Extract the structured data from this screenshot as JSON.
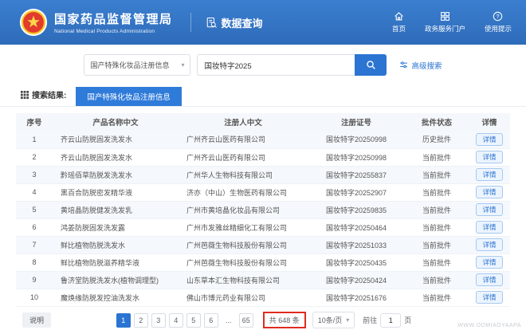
{
  "header": {
    "brand": {
      "title": "国家药品监督管理局",
      "subtitle": "National Medical Products Administration"
    },
    "app_title": "数据查询",
    "nav": [
      {
        "label": "首页",
        "icon": "home-icon"
      },
      {
        "label": "政务服务门户",
        "icon": "portal-icon"
      },
      {
        "label": "使用提示",
        "icon": "help-icon"
      }
    ]
  },
  "search": {
    "category_value": "国产特殊化妆品注册信息",
    "query_value": "国妆特字2025",
    "advanced_label": "高级搜索"
  },
  "results": {
    "label": "搜索结果:",
    "active_tab": "国产特殊化妆品注册信息"
  },
  "table": {
    "columns": [
      "序号",
      "产品名称中文",
      "注册人中文",
      "注册证号",
      "批件状态",
      "详情"
    ],
    "detail_label": "详情",
    "rows": [
      {
        "no": "1",
        "product": "齐云山防脱固发洗发水",
        "registrant": "广州齐云山医药有限公司",
        "cert": "国妆特字20250998",
        "status": "历史批件"
      },
      {
        "no": "2",
        "product": "齐云山防脱固发洗发水",
        "registrant": "广州齐云山医药有限公司",
        "cert": "国妆特字20250998",
        "status": "当前批件"
      },
      {
        "no": "3",
        "product": "黔瑶佰草防脱发洗发水",
        "registrant": "广州华人生物科技有限公司",
        "cert": "国妆特字20255837",
        "status": "当前批件"
      },
      {
        "no": "4",
        "product": "黑百合防脱密发精华液",
        "registrant": "济亦（中山）生物医药有限公司",
        "cert": "国妆特字20252907",
        "status": "当前批件"
      },
      {
        "no": "5",
        "product": "黄培晶防脱健发洗发乳",
        "registrant": "广州市黄培晶化妆品有限公司",
        "cert": "国妆特字20259835",
        "status": "当前批件"
      },
      {
        "no": "6",
        "product": "鸿姜防脱固发洗发露",
        "registrant": "广州市发雅丝精细化工有限公司",
        "cert": "国妆特字20250464",
        "status": "当前批件"
      },
      {
        "no": "7",
        "product": "鲜比植物防脱洗发水",
        "registrant": "广州芭薇生物科技股份有限公司",
        "cert": "国妆特字20251033",
        "status": "当前批件"
      },
      {
        "no": "8",
        "product": "鲜比植物防脱滋养精华液",
        "registrant": "广州芭薇生物科技股份有限公司",
        "cert": "国妆特字20250435",
        "status": "当前批件"
      },
      {
        "no": "9",
        "product": "鲁济堂防脱洗发水(植物调理型)",
        "registrant": "山东草本汇生物科技有限公司",
        "cert": "国妆特字20250424",
        "status": "当前批件"
      },
      {
        "no": "10",
        "product": "魔焕缘防脱发控油洗发水",
        "registrant": "佛山市博元药业有限公司",
        "cert": "国妆特字20251676",
        "status": "当前批件"
      }
    ]
  },
  "pagination": {
    "note_label": "说明",
    "pages": [
      "1",
      "2",
      "3",
      "4",
      "5",
      "6",
      "...",
      "65"
    ],
    "active_page": "1",
    "total_label": "共 648 条",
    "page_size": "10条/页",
    "goto_prefix": "前往",
    "goto_value": "1",
    "goto_suffix": "页"
  },
  "watermark": "WWW.ODMIAOYAAPA"
}
